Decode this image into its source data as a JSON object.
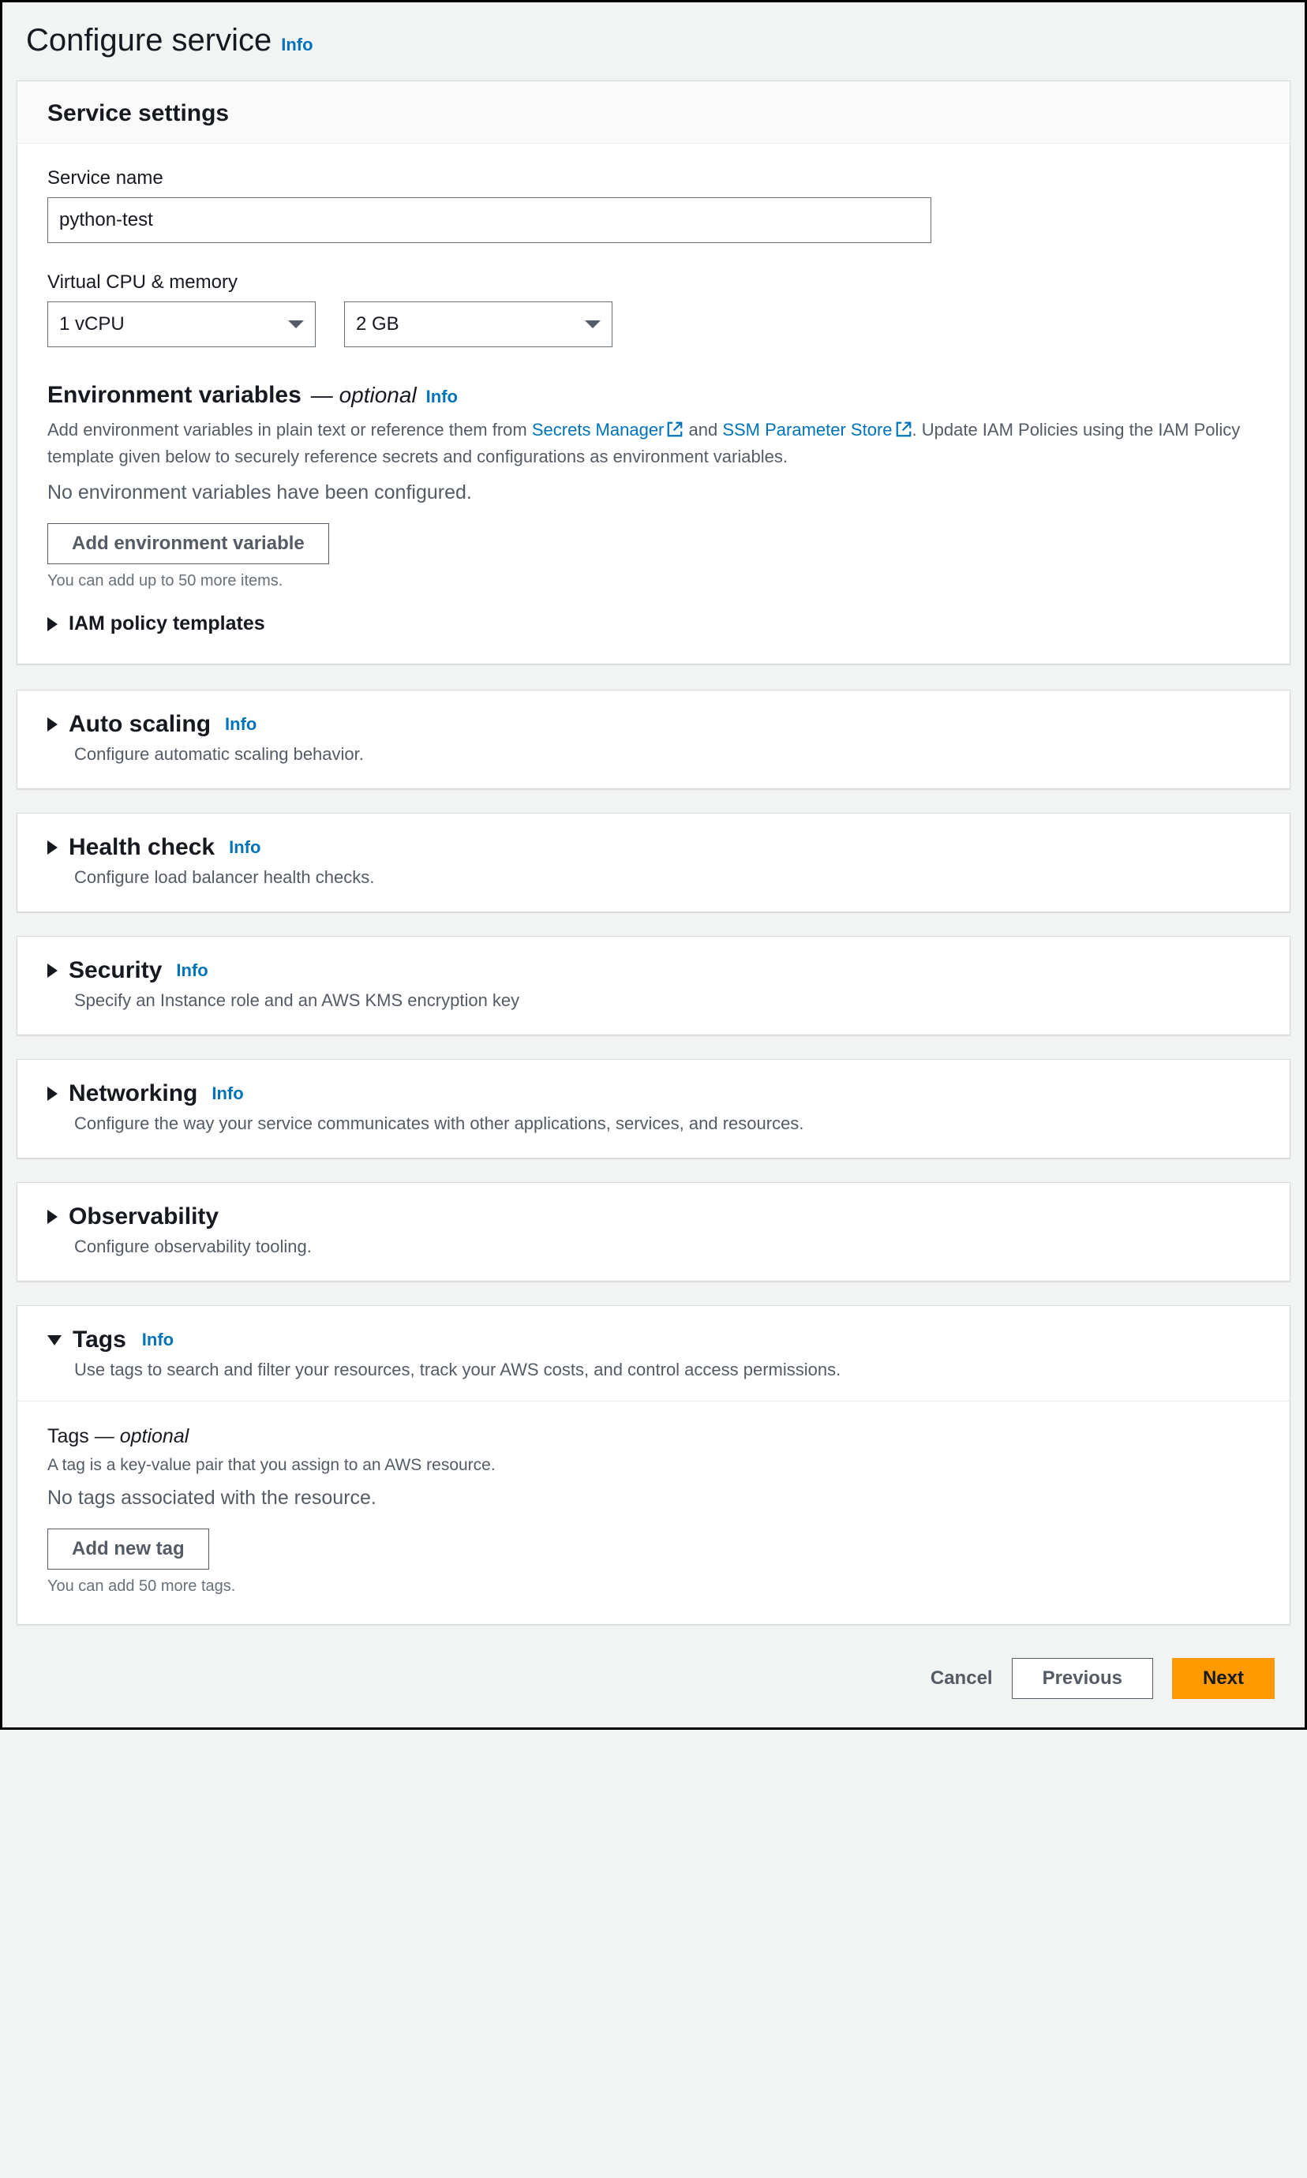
{
  "page": {
    "title": "Configure service",
    "info": "Info"
  },
  "settings": {
    "heading": "Service settings",
    "service_name_label": "Service name",
    "service_name_value": "python-test",
    "vcpu_label": "Virtual CPU & memory",
    "vcpu_value": "1 vCPU",
    "memory_value": "2 GB"
  },
  "env": {
    "heading": "Environment variables",
    "optional": "— optional",
    "info": "Info",
    "desc1_prefix": "Add environment variables in plain text or reference them from ",
    "secrets_link": "Secrets Manager",
    "desc1_mid": " and ",
    "ssm_link": "SSM Parameter Store",
    "desc1_suffix": ". Update IAM Policies using the IAM Policy template given below to securely reference secrets and configurations as environment variables.",
    "empty": "No environment variables have been configured.",
    "add_btn": "Add environment variable",
    "hint": "You can add up to 50 more items.",
    "iam_templates": "IAM policy templates"
  },
  "sections": {
    "autoscaling": {
      "title": "Auto scaling",
      "info": "Info",
      "desc": "Configure automatic scaling behavior."
    },
    "health": {
      "title": "Health check",
      "info": "Info",
      "desc": "Configure load balancer health checks."
    },
    "security": {
      "title": "Security",
      "info": "Info",
      "desc": "Specify an Instance role and an AWS KMS encryption key"
    },
    "networking": {
      "title": "Networking",
      "info": "Info",
      "desc": "Configure the way your service communicates with other applications, services, and resources."
    },
    "observability": {
      "title": "Observability",
      "desc": "Configure observability tooling."
    }
  },
  "tags": {
    "title": "Tags",
    "info": "Info",
    "desc": "Use tags to search and filter your resources, track your AWS costs, and control access permissions.",
    "sub_heading": "Tags",
    "optional": "— optional",
    "sub_desc": "A tag is a key-value pair that you assign to an AWS resource.",
    "empty": "No tags associated with the resource.",
    "add_btn": "Add new tag",
    "hint": "You can add 50 more tags."
  },
  "footer": {
    "cancel": "Cancel",
    "previous": "Previous",
    "next": "Next"
  }
}
